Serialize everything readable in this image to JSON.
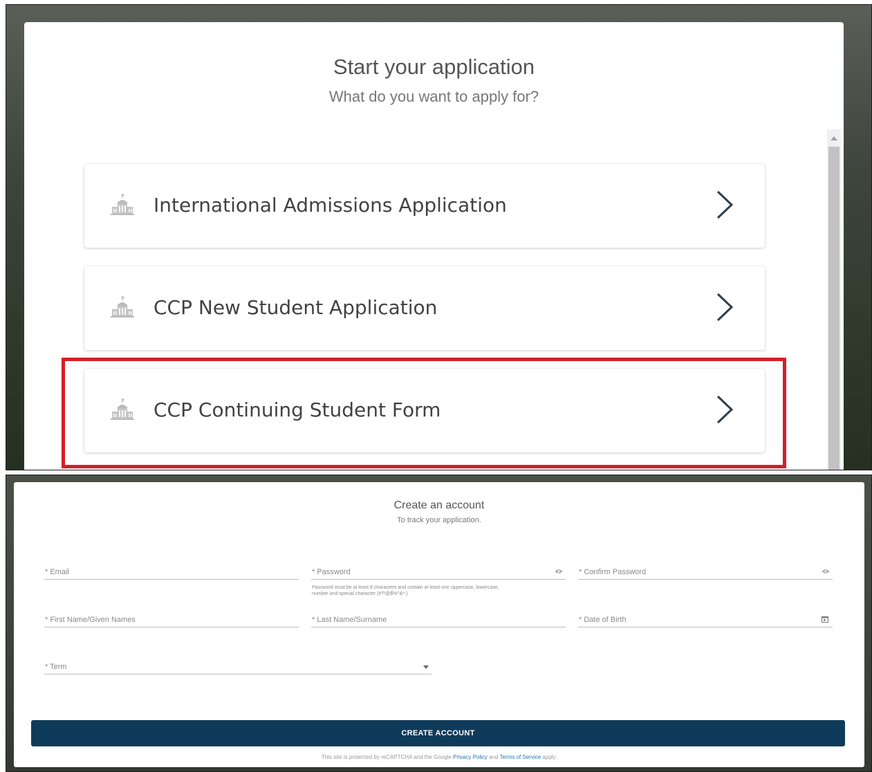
{
  "start": {
    "title": "Start your application",
    "subtitle": "What do you want to apply for?",
    "applications": [
      {
        "label": "International Admissions Application",
        "icon": "building-icon",
        "action": "chevron-right-icon"
      },
      {
        "label": "CCP New Student Application",
        "icon": "building-icon",
        "action": "chevron-right-icon"
      },
      {
        "label": "CCP Continuing Student Form",
        "icon": "building-icon",
        "action": "chevron-right-icon",
        "highlighted": true
      }
    ],
    "highlight_color": "#d51f28"
  },
  "account": {
    "title": "Create an account",
    "subtitle": "To track your application.",
    "fields": {
      "email": "* Email",
      "password": "* Password",
      "password_hint_line1": "Password must be at least 8 characters and contain at least one uppercase, lowercase,",
      "password_hint_line2": "number and special character (#?!@$%^&*-)",
      "confirm_password": "* Confirm Password",
      "first_name": "* First Name/Given Names",
      "last_name": "* Last Name/Surname",
      "date_of_birth": "* Date of Birth",
      "term": "* Term"
    },
    "create_button": "CREATE ACCOUNT",
    "captcha": {
      "prefix": "This site is protected by reCAPTCHA and the Google",
      "privacy": "Privacy Policy",
      "and": "and",
      "terms": "Terms of Service",
      "suffix": "apply."
    },
    "button_color": "#0f3b5b"
  }
}
